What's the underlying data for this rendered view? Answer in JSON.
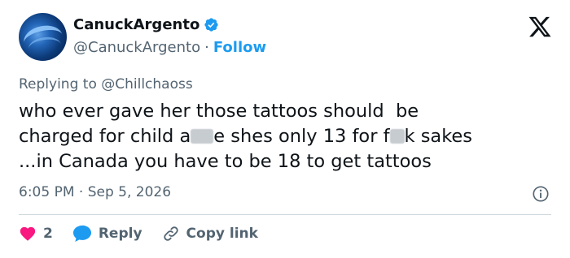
{
  "author": {
    "name": "CanuckArgento",
    "handle": "@CanuckArgento",
    "follow_label": "Follow",
    "separator": "·"
  },
  "reply_context": "Replying to @Chillchaoss",
  "tweet": {
    "part1": "who ever gave her those tattoos should  be\ncharged for child a",
    "part2": "e shes only 13 for f",
    "part3": "k sakes\n...in Canada you have to be 18 to get tattoos"
  },
  "meta": {
    "timestamp": "6:05 PM · Sep 5, 2026"
  },
  "actions": {
    "like_count": "2",
    "reply_label": "Reply",
    "copy_label": "Copy link"
  },
  "colors": {
    "accent": "#1d9bf0",
    "like": "#f91880",
    "muted": "#536471",
    "text": "#0f1419"
  },
  "icons": [
    "verified-badge-icon",
    "x-logo-icon",
    "info-icon",
    "heart-icon",
    "reply-bubble-icon",
    "link-icon"
  ]
}
